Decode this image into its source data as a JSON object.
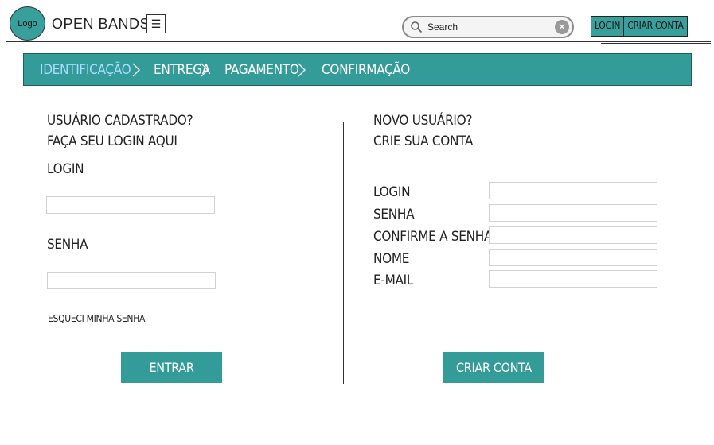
{
  "header": {
    "logo_text": "Logo",
    "brand": "OPEN BANDS",
    "menu_glyph": "☰",
    "search_placeholder": "Search",
    "login_label": "LOGIN",
    "signup_label": "CRIAR CONTA"
  },
  "steps": [
    {
      "label": "IDENTIFICAÇÃO",
      "active": true
    },
    {
      "label": "ENTREGA",
      "active": false
    },
    {
      "label": "PAGAMENTO",
      "active": false
    },
    {
      "label": "CONFIRMAÇÃO",
      "active": false
    }
  ],
  "returning": {
    "heading_1": "USUÁRIO CADASTRADO?",
    "heading_2": "FAÇA SEU LOGIN AQUI",
    "login_label": "LOGIN",
    "login_value": "",
    "password_label": "SENHA",
    "password_value": "",
    "forgot_link": "ESQUECI MINHA SENHA",
    "submit_label": "ENTRAR"
  },
  "new_user": {
    "heading_1": "NOVO USUÁRIO?",
    "heading_2": "CRIE SUA CONTA",
    "fields": [
      {
        "label": "LOGIN",
        "value": ""
      },
      {
        "label": "SENHA",
        "value": ""
      },
      {
        "label": "CONFIRME A SENHA",
        "value": ""
      },
      {
        "label": "NOME",
        "value": ""
      },
      {
        "label": "E-MAIL",
        "value": ""
      }
    ],
    "submit_label": "CRIAR CONTA"
  },
  "colors": {
    "accent": "#339b98",
    "active_step": "#a9dcff"
  },
  "icons": {
    "search": "search-icon",
    "clear": "clear-icon",
    "menu": "menu-icon",
    "chevron": "chevron-right-icon"
  }
}
